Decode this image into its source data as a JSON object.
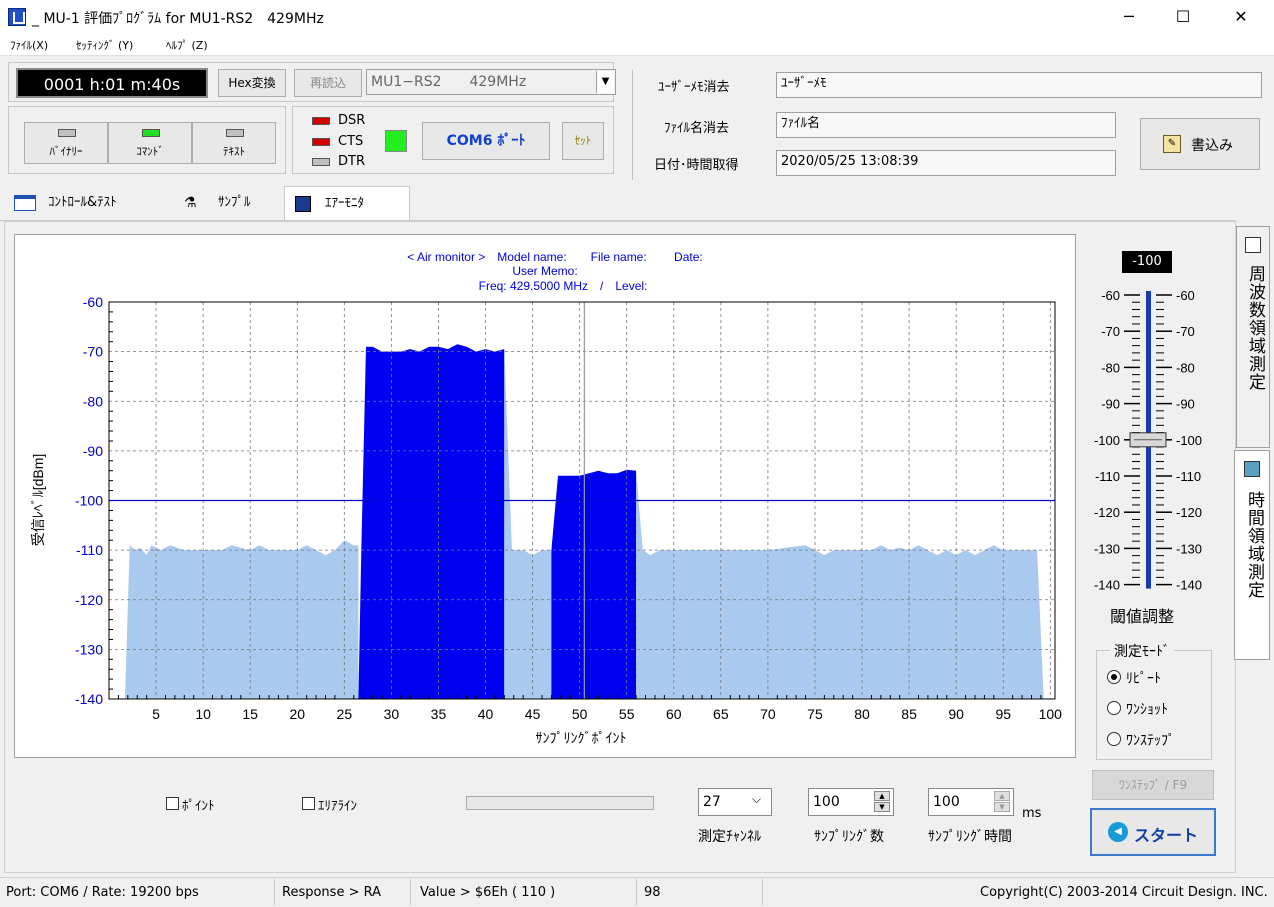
{
  "window": {
    "title": "_ MU-1 評価ﾌﾟﾛｸﾞﾗﾑ for MU1-RS2　429MHz",
    "minimize": "─",
    "maximize": "☐",
    "close": "✕"
  },
  "menu": {
    "file": "ﾌｧｲﾙ(X)",
    "setting": "ｾｯﾃｨﾝｸﾞ (Y)",
    "help": "ﾍﾙﾌﾟ (Z)"
  },
  "toolbar": {
    "timer": "0001 h:01 m:40s",
    "hex_button": "Hex変換",
    "reload_button": "再読込",
    "model_select": "MU1−RS2　　429MHz"
  },
  "modes": {
    "binary": "ﾊﾞｲﾅﾘｰ",
    "command": "ｺﾏﾝﾄﾞ",
    "text": "ﾃｷｽﾄ"
  },
  "signals": {
    "dsr": "DSR",
    "cts": "CTS",
    "dtr": "DTR",
    "com_button": "COM6 ﾎﾟｰﾄ",
    "set_button": "ｾｯﾄ",
    "dsr_color": "#d40000",
    "cts_color": "#d40000",
    "dtr_color": "#c0c0c0",
    "cts_indicator_color": "#22ee22"
  },
  "form": {
    "memo_clear": "ﾕｰｻﾞｰﾒﾓ消去",
    "memo_value": "ﾕｰｻﾞｰﾒﾓ",
    "filename_clear": "ﾌｧｲﾙ名消去",
    "filename_value": "ﾌｧｲﾙ名",
    "datetime_get": "日付･時間取得",
    "datetime_value": "2020/05/25 13:08:39",
    "write_button": "書込み"
  },
  "tabs": {
    "control": "ｺﾝﾄﾛｰﾙ&ﾃｽﾄ",
    "sample": "ｻﾝﾌﾟﾙ",
    "air": "ｴｱｰﾓﾆﾀ"
  },
  "chart_header": {
    "line1": "< Air monitor >　Model name:　　File name:　　 Date:",
    "line2": "User Memo:",
    "line3": "Freq: 429.5000 MHz　/　Level:"
  },
  "chart_data": {
    "type": "area",
    "xlabel": "ｻﾝﾌﾟﾘﾝｸﾞﾎﾟｲﾝﾄ",
    "ylabel": "受信ﾚﾍﾞﾙ[dBm]",
    "xlim": [
      0,
      100.5
    ],
    "ylim": [
      -140,
      -60
    ],
    "xticks": [
      5,
      10,
      15,
      20,
      25,
      30,
      35,
      40,
      45,
      50,
      55,
      60,
      65,
      70,
      75,
      80,
      85,
      90,
      95,
      100
    ],
    "yticks": [
      -60,
      -70,
      -80,
      -90,
      -100,
      -110,
      -120,
      -130,
      -140
    ],
    "grid": true,
    "threshold": -100,
    "cursor_x": 50.5,
    "colors": {
      "background_series": "#a9c9ee",
      "signal_series": "#0000f0",
      "threshold": "#0000d0",
      "axis_labels": "#0000cc"
    },
    "series": [
      {
        "points": [
          [
            1.7,
            -140
          ],
          [
            2.2,
            -109
          ],
          [
            2.8,
            -110
          ],
          [
            3.3,
            -109.5
          ],
          [
            4,
            -111
          ],
          [
            4.5,
            -109
          ],
          [
            5.5,
            -110
          ],
          [
            6.5,
            -109
          ],
          [
            8,
            -110
          ],
          [
            10,
            -110
          ],
          [
            12,
            -110
          ],
          [
            13,
            -109
          ],
          [
            15,
            -110
          ],
          [
            16,
            -109
          ],
          [
            17,
            -110
          ],
          [
            19,
            -110
          ],
          [
            20,
            -110
          ],
          [
            21,
            -109
          ],
          [
            22,
            -110
          ],
          [
            23,
            -111
          ],
          [
            24,
            -110
          ],
          [
            25,
            -108
          ],
          [
            26,
            -109
          ],
          [
            26.5,
            -109
          ],
          [
            26.5,
            -140
          ]
        ]
      },
      {
        "points": [
          [
            26.5,
            -140
          ],
          [
            26.8,
            -110
          ],
          [
            27.3,
            -69
          ],
          [
            28,
            -69
          ],
          [
            29,
            -70
          ],
          [
            30,
            -70
          ],
          [
            31,
            -70
          ],
          [
            32,
            -69.5
          ],
          [
            33,
            -70
          ],
          [
            34,
            -69
          ],
          [
            35,
            -69
          ],
          [
            36,
            -69.5
          ],
          [
            37,
            -68.5
          ],
          [
            38,
            -69
          ],
          [
            39,
            -70
          ],
          [
            40,
            -69.5
          ],
          [
            41,
            -70
          ],
          [
            42,
            -69.5
          ],
          [
            42,
            -140
          ]
        ]
      },
      {
        "points": [
          [
            42,
            -140
          ],
          [
            42,
            -69.5
          ],
          [
            42.8,
            -110
          ],
          [
            44,
            -110
          ],
          [
            45,
            -111
          ],
          [
            46,
            -110
          ],
          [
            47,
            -110
          ],
          [
            47,
            -140
          ]
        ]
      },
      {
        "points": [
          [
            47,
            -140
          ],
          [
            47,
            -110
          ],
          [
            47.7,
            -95
          ],
          [
            49,
            -95
          ],
          [
            50,
            -95
          ],
          [
            51,
            -94.5
          ],
          [
            52,
            -94
          ],
          [
            53,
            -94.5
          ],
          [
            54,
            -94.5
          ],
          [
            55,
            -93.8
          ],
          [
            56,
            -94
          ],
          [
            56,
            -140
          ]
        ]
      },
      {
        "points": [
          [
            56,
            -140
          ],
          [
            56,
            -94
          ],
          [
            56.7,
            -110
          ],
          [
            57.5,
            -111
          ],
          [
            58.5,
            -110
          ],
          [
            60,
            -110
          ],
          [
            62,
            -110
          ],
          [
            65,
            -110
          ],
          [
            68,
            -110
          ],
          [
            70,
            -110
          ],
          [
            72,
            -109.5
          ],
          [
            74,
            -109
          ],
          [
            75,
            -110
          ],
          [
            76,
            -111
          ],
          [
            77,
            -110
          ],
          [
            78,
            -110
          ],
          [
            80,
            -110
          ],
          [
            81,
            -110
          ],
          [
            82,
            -109
          ],
          [
            83,
            -110
          ],
          [
            84,
            -109.5
          ],
          [
            85,
            -110
          ],
          [
            86,
            -109
          ],
          [
            87,
            -110
          ],
          [
            88,
            -111
          ],
          [
            89,
            -110
          ],
          [
            90,
            -111
          ],
          [
            91,
            -110
          ],
          [
            92,
            -111
          ],
          [
            93,
            -110
          ],
          [
            94,
            -109
          ],
          [
            95,
            -110
          ],
          [
            96,
            -110
          ],
          [
            97,
            -110
          ],
          [
            98,
            -110
          ],
          [
            98.6,
            -110
          ],
          [
            99.3,
            -140
          ]
        ]
      }
    ],
    "series_color_index": [
      0,
      1,
      0,
      1,
      0
    ]
  },
  "threshold": {
    "value": "-100",
    "label": "閾値調整",
    "scale": [
      "-60",
      "-70",
      "-80",
      "-90",
      "-100",
      "-110",
      "-120",
      "-130",
      "-140"
    ],
    "level": -100
  },
  "vtabs": {
    "freq": "周波数領域測定",
    "time": "時間領域測定"
  },
  "measure_mode": {
    "title": "測定ﾓｰﾄﾞ",
    "repeat": "ﾘﾋﾟｰﾄ",
    "oneshot": "ﾜﾝｼｮｯﾄ",
    "onestep": "ﾜﾝｽﾃｯﾌﾟ"
  },
  "bottom": {
    "point": "ﾎﾟｲﾝﾄ",
    "arealine": "ｴﾘｱﾗｲﾝ",
    "channel_value": "27",
    "channel_label": "測定ﾁｬﾝﾈﾙ",
    "sample_count_value": "100",
    "sample_count_label": "ｻﾝﾌﾟﾘﾝｸﾞ数",
    "sample_time_value": "100",
    "sample_time_unit": "ms",
    "sample_time_label": "ｻﾝﾌﾟﾘﾝｸﾞ時間",
    "onestep_button": "ﾜﾝｽﾃｯﾌﾟ / F9",
    "start_button": "スタート"
  },
  "status": {
    "port": "Port: COM6 / Rate: 19200 bps",
    "response": "Response > RA",
    "value": "Value > $6Eh ( 110 )",
    "count": "98",
    "copyright": "Copyright(C) 2003-2014 Circuit Design. INC."
  }
}
